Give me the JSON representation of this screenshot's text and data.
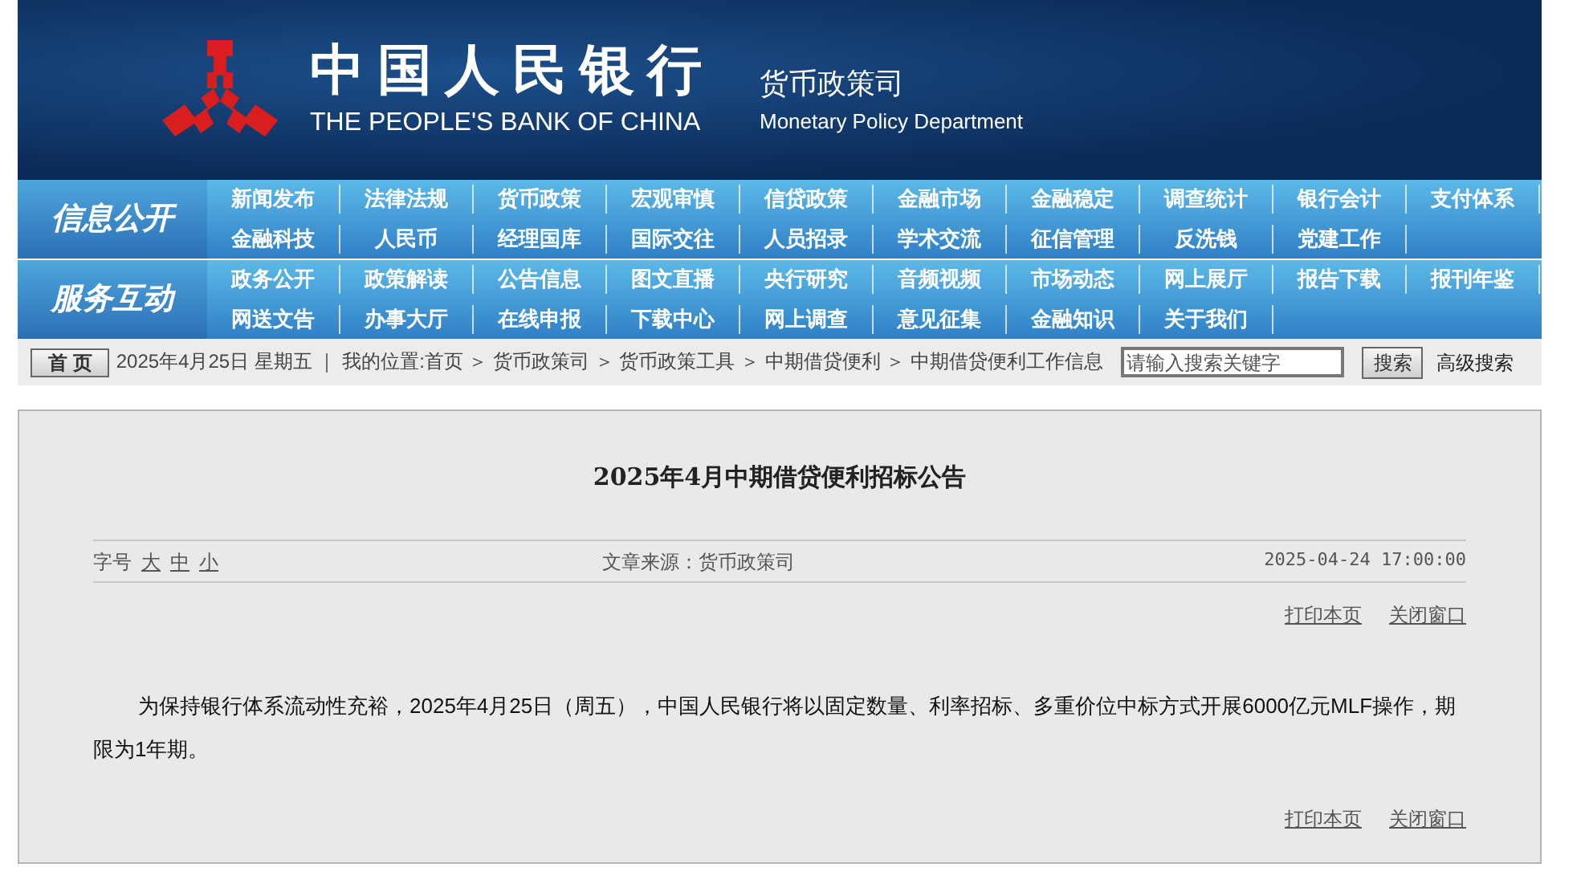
{
  "header": {
    "cn_name": "中国人民银行",
    "en_name": "THE PEOPLE'S BANK OF CHINA",
    "dept_cn": "货币政策司",
    "dept_en": "Monetary Policy Department"
  },
  "nav": [
    {
      "label": "信息公开",
      "rows": [
        [
          "新闻发布",
          "法律法规",
          "货币政策",
          "宏观审慎",
          "信贷政策",
          "金融市场",
          "金融稳定",
          "调查统计",
          "银行会计",
          "支付体系"
        ],
        [
          "金融科技",
          "人民币",
          "经理国库",
          "国际交往",
          "人员招录",
          "学术交流",
          "征信管理",
          "反洗钱",
          "党建工作"
        ]
      ]
    },
    {
      "label": "服务互动",
      "rows": [
        [
          "政务公开",
          "政策解读",
          "公告信息",
          "图文直播",
          "央行研究",
          "音频视频",
          "市场动态",
          "网上展厅",
          "报告下载",
          "报刊年鉴"
        ],
        [
          "网送文告",
          "办事大厅",
          "在线申报",
          "下载中心",
          "网上调查",
          "意见征集",
          "金融知识",
          "关于我们"
        ]
      ]
    }
  ],
  "breadcrumb": {
    "home_button": "首 页",
    "text": "2025年4月25日 星期五 ｜ 我的位置:首页 ＞ 货币政策司 ＞ 货币政策工具 ＞ 中期借贷便利 ＞ 中期借贷便利工作信息",
    "search_placeholder": "请输入搜索关键字",
    "search_button": "搜索",
    "advanced_search": "高级搜索"
  },
  "article": {
    "title": "2025年4月中期借贷便利招标公告",
    "font_size_label": "字号",
    "font_sizes": [
      "大",
      "中",
      "小"
    ],
    "source": "文章来源：货币政策司",
    "date": "2025-04-24 17:00:00",
    "top_links": [
      "打印本页",
      "关闭窗口"
    ],
    "body": "为保持银行体系流动性充裕，2025年4月25日（周五），中国人民银行将以固定数量、利率招标、多重价位中标方式开展6000亿元MLF操作，期限为1年期。",
    "bottom_links": [
      "打印本页",
      "关闭窗口"
    ]
  }
}
